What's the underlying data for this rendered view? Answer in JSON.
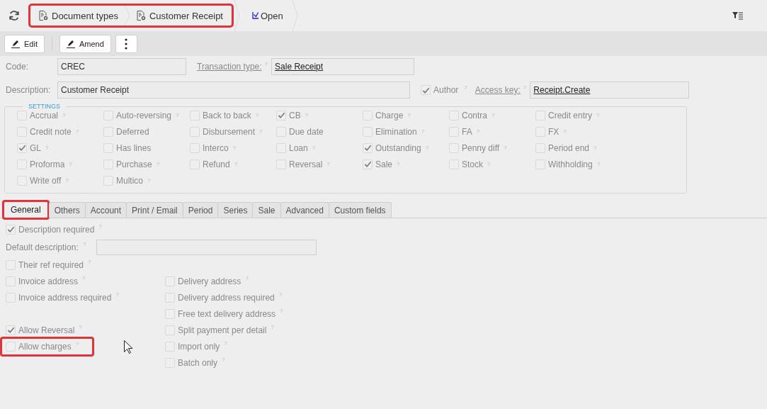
{
  "breadcrumb": {
    "highlighted": true,
    "items": [
      {
        "label": "Document types"
      },
      {
        "label": "Customer Receipt"
      }
    ]
  },
  "open_link": {
    "label": "Open"
  },
  "toolbar": {
    "buttons": [
      {
        "kind": "edit",
        "label": "Edit"
      },
      {
        "kind": "amend",
        "label": "Amend"
      },
      {
        "kind": "more"
      }
    ]
  },
  "form": {
    "code": {
      "label": "Code:",
      "value": "CREC"
    },
    "transaction_type": {
      "label": "Transaction type:",
      "help": "?",
      "value": "Sale Receipt"
    },
    "description": {
      "label": "Description:",
      "value": "Customer Receipt"
    },
    "author": {
      "label": "Author",
      "help": "?",
      "checked": true
    },
    "access_key": {
      "label": "Access key:",
      "help": "?",
      "value": "Receipt.Create"
    }
  },
  "settings": {
    "legend": "SETTINGS",
    "items": [
      {
        "label": "Accrual",
        "help": "?",
        "checked": false
      },
      {
        "label": "Auto-reversing",
        "help": "?",
        "checked": false
      },
      {
        "label": "Back to back",
        "help": "?",
        "checked": false
      },
      {
        "label": "CB",
        "help": "?",
        "checked": true
      },
      {
        "label": "Charge",
        "help": "?",
        "checked": false
      },
      {
        "label": "Contra",
        "help": "?",
        "checked": false
      },
      {
        "label": "Credit entry",
        "help": "?",
        "checked": false
      },
      {
        "label": "Credit note",
        "help": "?",
        "checked": false
      },
      {
        "label": "Deferred",
        "checked": false
      },
      {
        "label": "Disbursement",
        "help": "?",
        "checked": false
      },
      {
        "label": "Due date",
        "checked": false
      },
      {
        "label": "Elimination",
        "help": "?",
        "checked": false
      },
      {
        "label": "FA",
        "help": "?",
        "checked": false
      },
      {
        "label": "FX",
        "help": "?",
        "checked": false
      },
      {
        "label": "GL",
        "help": "?",
        "checked": true
      },
      {
        "label": "Has lines",
        "checked": false
      },
      {
        "label": "Interco",
        "help": "?",
        "checked": false
      },
      {
        "label": "Loan",
        "help": "?",
        "checked": false
      },
      {
        "label": "Outstanding",
        "help": "?",
        "checked": true
      },
      {
        "label": "Penny diff",
        "help": "?",
        "checked": false
      },
      {
        "label": "Period end",
        "help": "?",
        "checked": false
      },
      {
        "label": "Proforma",
        "help": "?",
        "checked": false
      },
      {
        "label": "Purchase",
        "help": "?",
        "checked": false
      },
      {
        "label": "Refund",
        "help": "?",
        "checked": false
      },
      {
        "label": "Reversal",
        "help": "?",
        "checked": false
      },
      {
        "label": "Sale",
        "help": "?",
        "checked": true
      },
      {
        "label": "Stock",
        "help": "?",
        "checked": false
      },
      {
        "label": "Withholding",
        "help": "?",
        "checked": false
      },
      {
        "label": "Write off",
        "help": "?",
        "checked": false
      },
      {
        "label": "Multico",
        "help": "?",
        "checked": false
      }
    ]
  },
  "tabs": [
    {
      "label": "General",
      "selected": true,
      "highlighted": true
    },
    {
      "label": "Others",
      "selected": false
    },
    {
      "label": "Account",
      "selected": false
    },
    {
      "label": "Print / Email",
      "selected": false
    },
    {
      "label": "Period",
      "selected": false
    },
    {
      "label": "Series",
      "selected": false
    },
    {
      "label": "Sale",
      "selected": false
    },
    {
      "label": "Advanced",
      "selected": false
    },
    {
      "label": "Custom fields",
      "selected": false
    }
  ],
  "general": {
    "description_required": {
      "label": "Description required",
      "help": "?",
      "checked": true
    },
    "default_description": {
      "label": "Default description:",
      "help": "?"
    },
    "their_ref_required": {
      "label": "Their ref required",
      "help": "?",
      "checked": false
    },
    "left_groups": [
      [
        {
          "label": "Invoice address",
          "help": "?",
          "checked": false
        },
        {
          "label": "Invoice address required",
          "help": "?",
          "checked": false
        }
      ],
      [
        {
          "label": "Allow Reversal",
          "help": "?",
          "checked": true
        },
        {
          "label": "Allow charges",
          "help": "?",
          "checked": false,
          "highlighted": true
        }
      ]
    ],
    "right": [
      {
        "label": "Delivery address",
        "help": "?",
        "checked": false
      },
      {
        "label": "Delivery address required",
        "help": "?",
        "checked": false
      },
      {
        "label": "Free text delivery address",
        "help": "?",
        "checked": false
      },
      {
        "label": "Split payment per detail",
        "help": "?",
        "checked": false
      },
      {
        "label": "Import only",
        "help": "?",
        "checked": false
      },
      {
        "label": "Batch only",
        "help": "?",
        "checked": false
      }
    ]
  }
}
